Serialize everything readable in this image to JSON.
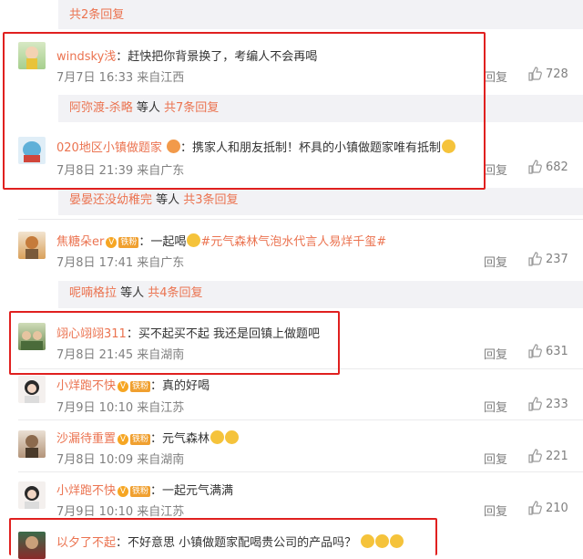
{
  "top_sub": {
    "count_text": "共2条回复"
  },
  "comments": [
    {
      "user": "windsky浅",
      "sep": "：",
      "text": "赶快把你背景换了，考编人不会再喝",
      "date": "7月7日 16:33",
      "origin": "来自江西",
      "reply": "回复",
      "likes": "728"
    },
    {
      "user": "020地区小镇做题家",
      "sep": "：",
      "text": "携家人和朋友抵制！杯具的小镇做题家唯有抵制",
      "date": "7月8日 21:39",
      "origin": "来自广东",
      "reply": "回复",
      "likes": "682"
    },
    {
      "user": "焦糖朵er",
      "sep": "：",
      "text": "一起喝",
      "hashtag": "#元气森林气泡水代言人易烊千玺#",
      "date": "7月8日 17:41",
      "origin": "来自广东",
      "reply": "回复",
      "likes": "237"
    },
    {
      "user": "翊心翊翊311",
      "sep": "：",
      "text": "买不起买不起 我还是回镇上做题吧",
      "date": "7月8日 21:45",
      "origin": "来自湖南",
      "reply": "回复",
      "likes": "631"
    },
    {
      "user": "小烊跑不快",
      "sep": "：",
      "text": "真的好喝",
      "date": "7月9日 10:10",
      "origin": "来自江苏",
      "reply": "回复",
      "likes": "233"
    },
    {
      "user": "沙漏待重置",
      "sep": "：",
      "text": "元气森林",
      "date": "7月8日 10:09",
      "origin": "来自湖南",
      "reply": "回复",
      "likes": "221"
    },
    {
      "user": "小烊跑不快",
      "sep": "：",
      "text": "一起元气满满",
      "date": "7月9日 10:10",
      "origin": "来自江苏",
      "reply": "回复",
      "likes": "210"
    },
    {
      "user": "以夕了不起",
      "sep": "：",
      "text": "不好意思 小镇做题家配喝贵公司的产品吗？"
    }
  ],
  "subs": [
    {
      "name": "阿弥渡-杀略",
      "mid": " 等人 ",
      "count": "共7条回复"
    },
    {
      "name": "晏晏还没幼稚完",
      "mid": " 等人 ",
      "count": "共3条回复"
    },
    {
      "name": "呢喃格拉",
      "mid": " 等人 ",
      "count": "共4条回复"
    }
  ],
  "badge": "铁粉",
  "colors": {
    "accent": "#eb7350",
    "highlight": "#e0201f",
    "subbg": "#f2f2f5"
  }
}
